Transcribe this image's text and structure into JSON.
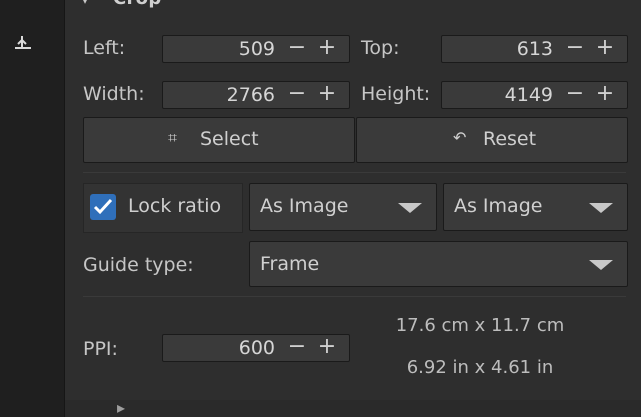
{
  "sidebar": {
    "tool_icon": "crop-tool-icon"
  },
  "crop": {
    "section_arrow": "▾",
    "title": "Crop",
    "left_label": "Left:",
    "left_value": "509",
    "top_label": "Top:",
    "top_value": "613",
    "width_label": "Width:",
    "width_value": "2766",
    "height_label": "Height:",
    "height_value": "4149",
    "minus": "−",
    "plus": "+",
    "select_label": "Select",
    "reset_label": "Reset",
    "lock_ratio_label": "Lock ratio",
    "lock_ratio_checked": true,
    "ratio_combo_1": "As Image",
    "ratio_combo_2": "As Image",
    "guide_type_label": "Guide type:",
    "guide_type_value": "Frame",
    "ppi_label": "PPI:",
    "ppi_value": "600",
    "size_cm": "17.6 cm x 11.7 cm",
    "size_in": "6.92 in x 4.61 in"
  },
  "next_section": {
    "arrow": "▸"
  }
}
